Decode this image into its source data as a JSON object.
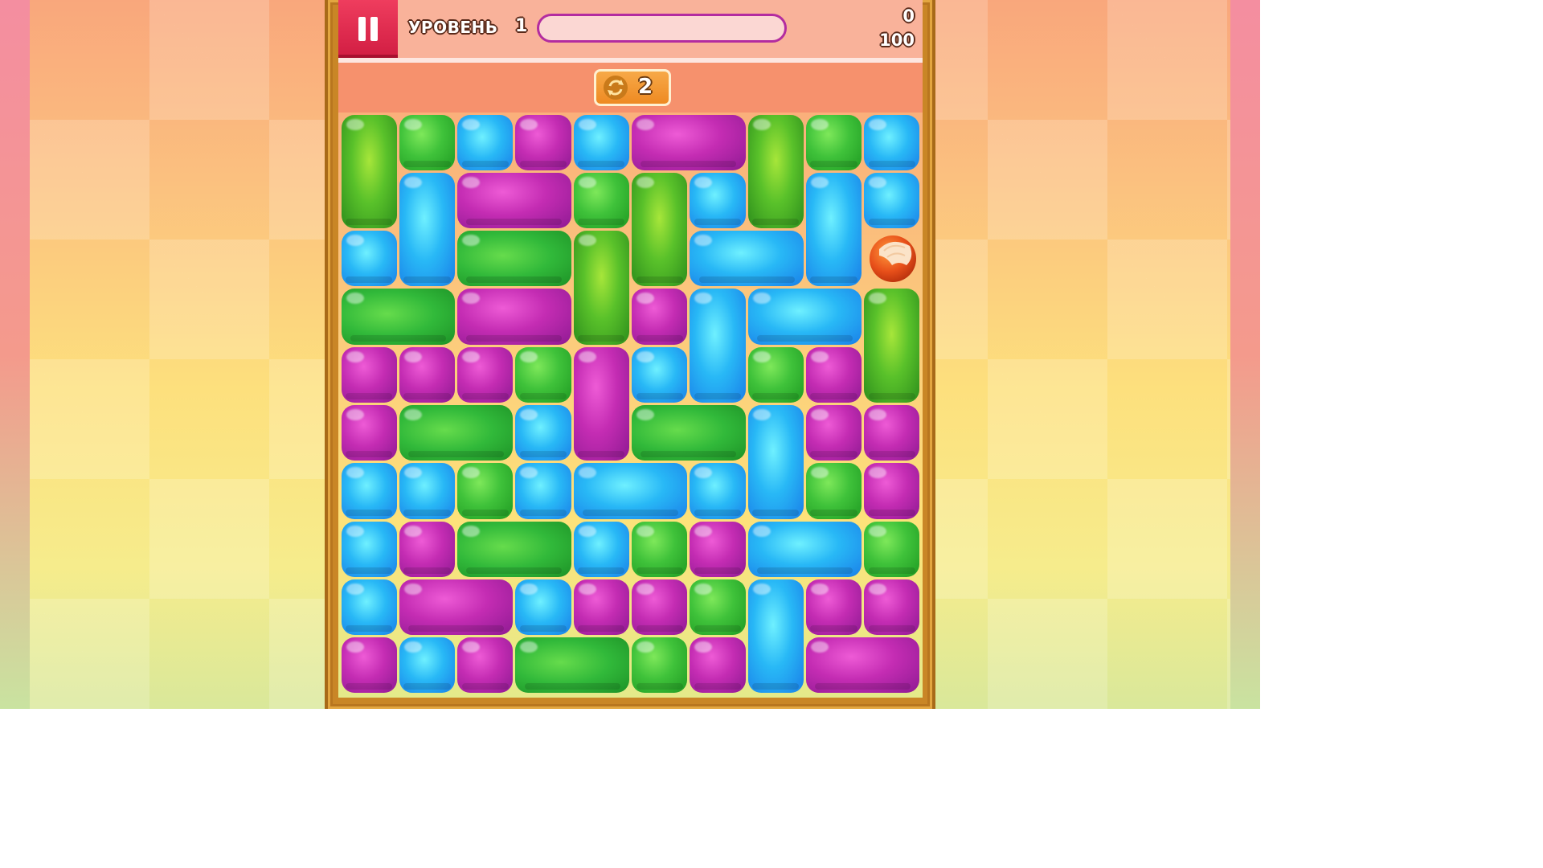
{
  "header": {
    "level_label": "УРОВЕНЬ",
    "level_number": "1",
    "progress_fraction": 0,
    "score": "0",
    "target_score": "100"
  },
  "pause_button": {
    "icon": "pause-icon"
  },
  "shuffle": {
    "icon": "shuffle-icon",
    "count": "2"
  },
  "colors": {
    "green": "#3fc23a",
    "blue": "#28b8f6",
    "purple": "#c42cb3",
    "pause": "#d11d42",
    "progress_border": "#b32ca0",
    "frame": "#c98626"
  },
  "grid": {
    "cols": 10,
    "rows": 10,
    "pieces": [
      {
        "c": 0,
        "r": 0,
        "w": 1,
        "h": 2,
        "color": "green"
      },
      {
        "c": 1,
        "r": 0,
        "w": 1,
        "h": 1,
        "color": "green"
      },
      {
        "c": 2,
        "r": 0,
        "w": 1,
        "h": 1,
        "color": "blue"
      },
      {
        "c": 3,
        "r": 0,
        "w": 1,
        "h": 1,
        "color": "purple"
      },
      {
        "c": 4,
        "r": 0,
        "w": 1,
        "h": 1,
        "color": "blue"
      },
      {
        "c": 5,
        "r": 0,
        "w": 2,
        "h": 1,
        "color": "purple"
      },
      {
        "c": 7,
        "r": 0,
        "w": 1,
        "h": 2,
        "color": "green"
      },
      {
        "c": 8,
        "r": 0,
        "w": 1,
        "h": 1,
        "color": "green"
      },
      {
        "c": 9,
        "r": 0,
        "w": 1,
        "h": 1,
        "color": "blue"
      },
      {
        "c": 1,
        "r": 1,
        "w": 1,
        "h": 2,
        "color": "blue"
      },
      {
        "c": 2,
        "r": 1,
        "w": 2,
        "h": 1,
        "color": "purple"
      },
      {
        "c": 4,
        "r": 1,
        "w": 1,
        "h": 1,
        "color": "green"
      },
      {
        "c": 5,
        "r": 1,
        "w": 1,
        "h": 2,
        "color": "green"
      },
      {
        "c": 6,
        "r": 1,
        "w": 1,
        "h": 1,
        "color": "blue"
      },
      {
        "c": 8,
        "r": 1,
        "w": 1,
        "h": 2,
        "color": "blue"
      },
      {
        "c": 9,
        "r": 1,
        "w": 1,
        "h": 1,
        "color": "blue"
      },
      {
        "c": 0,
        "r": 2,
        "w": 1,
        "h": 1,
        "color": "blue"
      },
      {
        "c": 2,
        "r": 2,
        "w": 2,
        "h": 1,
        "color": "green"
      },
      {
        "c": 4,
        "r": 2,
        "w": 1,
        "h": 2,
        "color": "green"
      },
      {
        "c": 6,
        "r": 2,
        "w": 2,
        "h": 1,
        "color": "blue"
      },
      {
        "c": 0,
        "r": 3,
        "w": 2,
        "h": 1,
        "color": "green"
      },
      {
        "c": 2,
        "r": 3,
        "w": 2,
        "h": 1,
        "color": "purple"
      },
      {
        "c": 5,
        "r": 3,
        "w": 1,
        "h": 1,
        "color": "purple"
      },
      {
        "c": 6,
        "r": 3,
        "w": 1,
        "h": 2,
        "color": "blue"
      },
      {
        "c": 7,
        "r": 3,
        "w": 2,
        "h": 1,
        "color": "blue"
      },
      {
        "c": 9,
        "r": 3,
        "w": 1,
        "h": 2,
        "color": "green"
      },
      {
        "c": 0,
        "r": 4,
        "w": 1,
        "h": 1,
        "color": "purple"
      },
      {
        "c": 1,
        "r": 4,
        "w": 1,
        "h": 1,
        "color": "purple"
      },
      {
        "c": 2,
        "r": 4,
        "w": 1,
        "h": 1,
        "color": "purple"
      },
      {
        "c": 3,
        "r": 4,
        "w": 1,
        "h": 1,
        "color": "green"
      },
      {
        "c": 4,
        "r": 4,
        "w": 1,
        "h": 2,
        "color": "purple"
      },
      {
        "c": 5,
        "r": 4,
        "w": 1,
        "h": 1,
        "color": "blue"
      },
      {
        "c": 7,
        "r": 4,
        "w": 1,
        "h": 1,
        "color": "green"
      },
      {
        "c": 8,
        "r": 4,
        "w": 1,
        "h": 1,
        "color": "purple"
      },
      {
        "c": 0,
        "r": 5,
        "w": 1,
        "h": 1,
        "color": "purple"
      },
      {
        "c": 1,
        "r": 5,
        "w": 2,
        "h": 1,
        "color": "green"
      },
      {
        "c": 3,
        "r": 5,
        "w": 1,
        "h": 1,
        "color": "blue"
      },
      {
        "c": 5,
        "r": 5,
        "w": 2,
        "h": 1,
        "color": "green"
      },
      {
        "c": 7,
        "r": 5,
        "w": 1,
        "h": 2,
        "color": "blue"
      },
      {
        "c": 8,
        "r": 5,
        "w": 1,
        "h": 1,
        "color": "purple"
      },
      {
        "c": 9,
        "r": 5,
        "w": 1,
        "h": 1,
        "color": "purple"
      },
      {
        "c": 0,
        "r": 6,
        "w": 1,
        "h": 1,
        "color": "blue"
      },
      {
        "c": 1,
        "r": 6,
        "w": 1,
        "h": 1,
        "color": "blue"
      },
      {
        "c": 2,
        "r": 6,
        "w": 1,
        "h": 1,
        "color": "green"
      },
      {
        "c": 3,
        "r": 6,
        "w": 1,
        "h": 1,
        "color": "blue"
      },
      {
        "c": 4,
        "r": 6,
        "w": 2,
        "h": 1,
        "color": "blue"
      },
      {
        "c": 6,
        "r": 6,
        "w": 1,
        "h": 1,
        "color": "blue"
      },
      {
        "c": 8,
        "r": 6,
        "w": 1,
        "h": 1,
        "color": "green"
      },
      {
        "c": 9,
        "r": 6,
        "w": 1,
        "h": 1,
        "color": "purple"
      },
      {
        "c": 0,
        "r": 7,
        "w": 1,
        "h": 1,
        "color": "blue"
      },
      {
        "c": 1,
        "r": 7,
        "w": 1,
        "h": 1,
        "color": "purple"
      },
      {
        "c": 2,
        "r": 7,
        "w": 2,
        "h": 1,
        "color": "green"
      },
      {
        "c": 4,
        "r": 7,
        "w": 1,
        "h": 1,
        "color": "blue"
      },
      {
        "c": 5,
        "r": 7,
        "w": 1,
        "h": 1,
        "color": "green"
      },
      {
        "c": 6,
        "r": 7,
        "w": 1,
        "h": 1,
        "color": "purple"
      },
      {
        "c": 7,
        "r": 7,
        "w": 2,
        "h": 1,
        "color": "blue"
      },
      {
        "c": 9,
        "r": 7,
        "w": 1,
        "h": 1,
        "color": "green"
      },
      {
        "c": 0,
        "r": 8,
        "w": 1,
        "h": 1,
        "color": "blue"
      },
      {
        "c": 1,
        "r": 8,
        "w": 2,
        "h": 1,
        "color": "purple"
      },
      {
        "c": 3,
        "r": 8,
        "w": 1,
        "h": 1,
        "color": "blue"
      },
      {
        "c": 4,
        "r": 8,
        "w": 1,
        "h": 1,
        "color": "purple"
      },
      {
        "c": 5,
        "r": 8,
        "w": 1,
        "h": 1,
        "color": "purple"
      },
      {
        "c": 6,
        "r": 8,
        "w": 1,
        "h": 1,
        "color": "green"
      },
      {
        "c": 7,
        "r": 8,
        "w": 1,
        "h": 2,
        "color": "blue"
      },
      {
        "c": 8,
        "r": 8,
        "w": 1,
        "h": 1,
        "color": "purple"
      },
      {
        "c": 9,
        "r": 8,
        "w": 1,
        "h": 1,
        "color": "purple"
      },
      {
        "c": 0,
        "r": 9,
        "w": 1,
        "h": 1,
        "color": "purple"
      },
      {
        "c": 1,
        "r": 9,
        "w": 1,
        "h": 1,
        "color": "blue"
      },
      {
        "c": 2,
        "r": 9,
        "w": 1,
        "h": 1,
        "color": "purple"
      },
      {
        "c": 3,
        "r": 9,
        "w": 2,
        "h": 1,
        "color": "green"
      },
      {
        "c": 5,
        "r": 9,
        "w": 1,
        "h": 1,
        "color": "green"
      },
      {
        "c": 6,
        "r": 9,
        "w": 1,
        "h": 1,
        "color": "purple"
      },
      {
        "c": 8,
        "r": 9,
        "w": 2,
        "h": 1,
        "color": "purple"
      }
    ],
    "special": {
      "c": 9,
      "r": 2,
      "type": "hazelnut",
      "icon": "hazelnut-icon"
    }
  }
}
